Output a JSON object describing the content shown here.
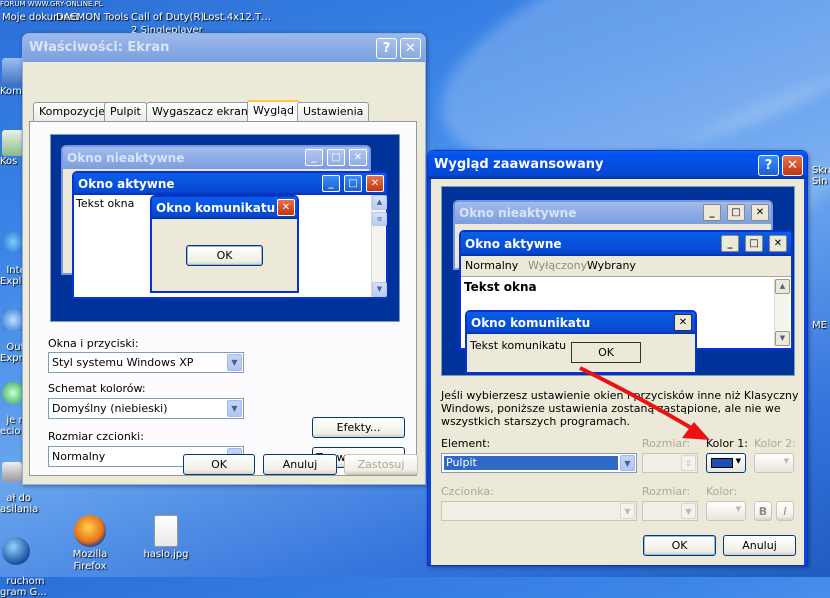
{
  "colors": {
    "accent": "#0a5fe4",
    "desktop": "#3d86e8",
    "preview_bg": "#003399",
    "arrow": "#ee1111"
  },
  "desktop": {
    "topstrip_left": "FORUM WWW.GRY-ONLINE.PL",
    "top_icon_labels": [
      "Moje\ndokument",
      "DAEMON Tools",
      "Call of Duty(R)",
      "Lost.4x12.T…",
      "2 Singleplayer"
    ],
    "left_icon_labels": [
      "Kom",
      "Kos",
      "Intern\nExplo",
      "Outlo\nExpre",
      "je mi\necio",
      "ał do\nasilania",
      "ruchom\ngram G..."
    ],
    "bottom_icons": [
      "Mozilla Firefox",
      "haslo.jpg"
    ],
    "right_edge_labels": [
      "Skró\nSin",
      "ME"
    ]
  },
  "display_props": {
    "title": "Właściwości: Ekran",
    "tabs": [
      "Kompozycje",
      "Pulpit",
      "Wygaszacz ekranu",
      "Wygląd",
      "Ustawienia"
    ],
    "selected_tab": "Wygląd",
    "preview": {
      "inactive_title": "Okno nieaktywne",
      "active_title": "Okno aktywne",
      "window_text": "Tekst okna",
      "message_title": "Okno komunikatu",
      "ok": "OK"
    },
    "windows_buttons_label": "Okna i przyciski:",
    "windows_buttons_value": "Styl systemu Windows XP",
    "color_scheme_label": "Schemat kolorów:",
    "color_scheme_value": "Domyślny (niebieski)",
    "font_size_label": "Rozmiar czcionki:",
    "font_size_value": "Normalny",
    "effects_button": "Efekty...",
    "advanced_button": "Zaawansowane",
    "ok_button": "OK",
    "cancel_button": "Anuluj",
    "apply_button": "Zastosuj"
  },
  "advanced": {
    "title": "Wygląd zaawansowany",
    "preview": {
      "inactive_title": "Okno nieaktywne",
      "active_title": "Okno aktywne",
      "menu": [
        "Normalny",
        "Wyłączony",
        "Wybrany"
      ],
      "window_text": "Tekst okna",
      "message_title": "Okno komunikatu",
      "message_text": "Tekst komunikatu",
      "ok": "OK"
    },
    "info_text": "Jeśli wybierzesz ustawienie okien i przycisków inne niż Klasyczny Windows, poniższe ustawienia zostaną zastąpione, ale nie we wszystkich starszych programach.",
    "element_label": "Element:",
    "element_value": "Pulpit",
    "size_label": "Rozmiar:",
    "color1_label": "Kolor 1:",
    "color2_label": "Kolor 2:",
    "font_label": "Czcionka:",
    "font_size_label": "Rozmiar:",
    "font_color_label": "Kolor:",
    "bold_label": "B",
    "italic_label": "I",
    "ok_button": "OK",
    "cancel_button": "Anuluj"
  }
}
